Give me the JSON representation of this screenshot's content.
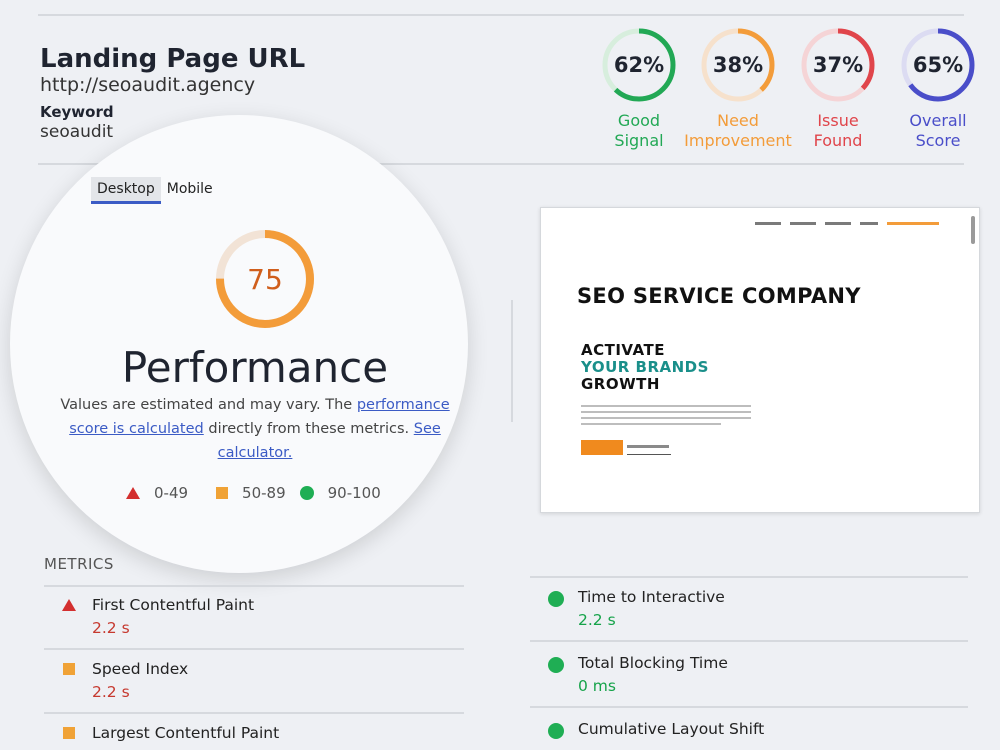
{
  "header": {
    "title": "Landing Page URL",
    "url": "http://seoaudit.agency",
    "keyword_label": "Keyword",
    "keyword": "seoaudit"
  },
  "scores": [
    {
      "value": "62%",
      "percent": 62,
      "label_line1": "Good",
      "label_line2": "Signal",
      "color": "#22a855",
      "track": "#d7eedd"
    },
    {
      "value": "38%",
      "percent": 38,
      "label_line1": "Need",
      "label_line2": "Improvement",
      "color": "#f39c3a",
      "track": "#f6e1cc"
    },
    {
      "value": "37%",
      "percent": 37,
      "label_line1": "Issue",
      "label_line2": "Found",
      "color": "#e0454b",
      "track": "#f5d4d6"
    },
    {
      "value": "65%",
      "percent": 65,
      "label_line1": "Overall",
      "label_line2": "Score",
      "color": "#4a4ec9",
      "track": "#dcdcf2"
    }
  ],
  "tabs": {
    "desktop": "Desktop",
    "mobile": "Mobile"
  },
  "performance": {
    "score": "75",
    "score_percent": 75,
    "title": "Performance",
    "desc_prefix": "Values are estimated and may vary. The ",
    "desc_link1": "performance score is calculated",
    "desc_middle": " directly from these metrics. ",
    "desc_link2": "See calculator.",
    "gauge_color": "#f39c3a",
    "gauge_track": "#f2e3d6"
  },
  "legend": {
    "poor": "0-49",
    "average": "50-89",
    "good": "90-100"
  },
  "preview": {
    "title": "SEO SERVICE COMPANY",
    "line1": "ACTIVATE",
    "line2": "YOUR BRANDS",
    "line3": "GROWTH",
    "accent": "#1a8f8a"
  },
  "metrics_label": "METRICS",
  "metrics_left": [
    {
      "name": "First Contentful Paint",
      "value": "2.2 s",
      "status": "poor"
    },
    {
      "name": "Speed Index",
      "value": "2.2 s",
      "status": "average"
    },
    {
      "name": "Largest Contentful Paint",
      "value": "",
      "status": "average"
    }
  ],
  "metrics_right": [
    {
      "name": "Time to Interactive",
      "value": "2.2 s",
      "status": "good"
    },
    {
      "name": "Total Blocking Time",
      "value": "0 ms",
      "status": "good"
    },
    {
      "name": "Cumulative Layout Shift",
      "value": "",
      "status": "good"
    }
  ]
}
